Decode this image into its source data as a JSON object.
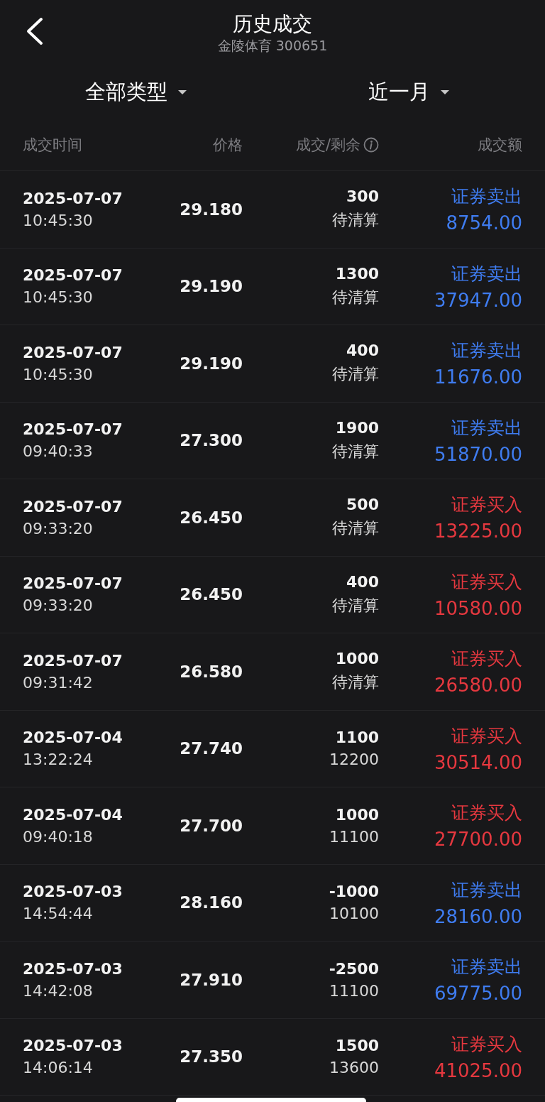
{
  "header": {
    "title": "历史成交",
    "subtitle": "金陵体育 300651"
  },
  "filters": [
    {
      "label": "全部类型"
    },
    {
      "label": "近一月"
    }
  ],
  "table": {
    "columns": [
      "成交时间",
      "价格",
      "成交/剩余",
      "成交额"
    ],
    "rows": [
      {
        "date": "2025-07-07",
        "time": "10:45:30",
        "price": "29.180",
        "filled": "300",
        "remaining": "待清算",
        "kind": "sell",
        "type": "证券卖出",
        "amount": "8754.00"
      },
      {
        "date": "2025-07-07",
        "time": "10:45:30",
        "price": "29.190",
        "filled": "1300",
        "remaining": "待清算",
        "kind": "sell",
        "type": "证券卖出",
        "amount": "37947.00"
      },
      {
        "date": "2025-07-07",
        "time": "10:45:30",
        "price": "29.190",
        "filled": "400",
        "remaining": "待清算",
        "kind": "sell",
        "type": "证券卖出",
        "amount": "11676.00"
      },
      {
        "date": "2025-07-07",
        "time": "09:40:33",
        "price": "27.300",
        "filled": "1900",
        "remaining": "待清算",
        "kind": "sell",
        "type": "证券卖出",
        "amount": "51870.00"
      },
      {
        "date": "2025-07-07",
        "time": "09:33:20",
        "price": "26.450",
        "filled": "500",
        "remaining": "待清算",
        "kind": "buy",
        "type": "证券买入",
        "amount": "13225.00"
      },
      {
        "date": "2025-07-07",
        "time": "09:33:20",
        "price": "26.450",
        "filled": "400",
        "remaining": "待清算",
        "kind": "buy",
        "type": "证券买入",
        "amount": "10580.00"
      },
      {
        "date": "2025-07-07",
        "time": "09:31:42",
        "price": "26.580",
        "filled": "1000",
        "remaining": "待清算",
        "kind": "buy",
        "type": "证券买入",
        "amount": "26580.00"
      },
      {
        "date": "2025-07-04",
        "time": "13:22:24",
        "price": "27.740",
        "filled": "1100",
        "remaining": "12200",
        "kind": "buy",
        "type": "证券买入",
        "amount": "30514.00"
      },
      {
        "date": "2025-07-04",
        "time": "09:40:18",
        "price": "27.700",
        "filled": "1000",
        "remaining": "11100",
        "kind": "buy",
        "type": "证券买入",
        "amount": "27700.00"
      },
      {
        "date": "2025-07-03",
        "time": "14:54:44",
        "price": "28.160",
        "filled": "-1000",
        "remaining": "10100",
        "kind": "sell",
        "type": "证券卖出",
        "amount": "28160.00"
      },
      {
        "date": "2025-07-03",
        "time": "14:42:08",
        "price": "27.910",
        "filled": "-2500",
        "remaining": "11100",
        "kind": "sell",
        "type": "证券卖出",
        "amount": "69775.00"
      },
      {
        "date": "2025-07-03",
        "time": "14:06:14",
        "price": "27.350",
        "filled": "1500",
        "remaining": "13600",
        "kind": "buy",
        "type": "证券买入",
        "amount": "41025.00"
      }
    ]
  }
}
